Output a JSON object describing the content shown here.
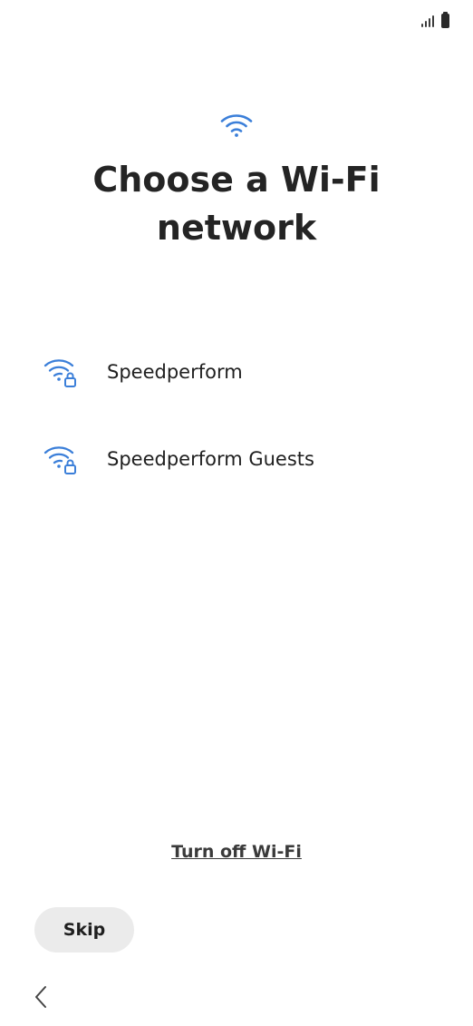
{
  "status_bar": {
    "signal_icon": "signal-icon",
    "battery_icon": "battery-icon"
  },
  "header": {
    "icon": "wifi-icon",
    "title_line1": "Choose a Wi-Fi",
    "title_line2": "network"
  },
  "networks": [
    {
      "name": "Speedperform",
      "icon": "wifi-lock-icon"
    },
    {
      "name": "Speedperform Guests",
      "icon": "wifi-lock-icon"
    }
  ],
  "actions": {
    "turn_off_wifi": "Turn off Wi-Fi",
    "skip": "Skip"
  },
  "nav": {
    "back_icon": "back-chevron-icon"
  },
  "colors": {
    "accent": "#3b7fd9",
    "text": "#1f1f1f",
    "button_bg": "#ebebeb"
  }
}
